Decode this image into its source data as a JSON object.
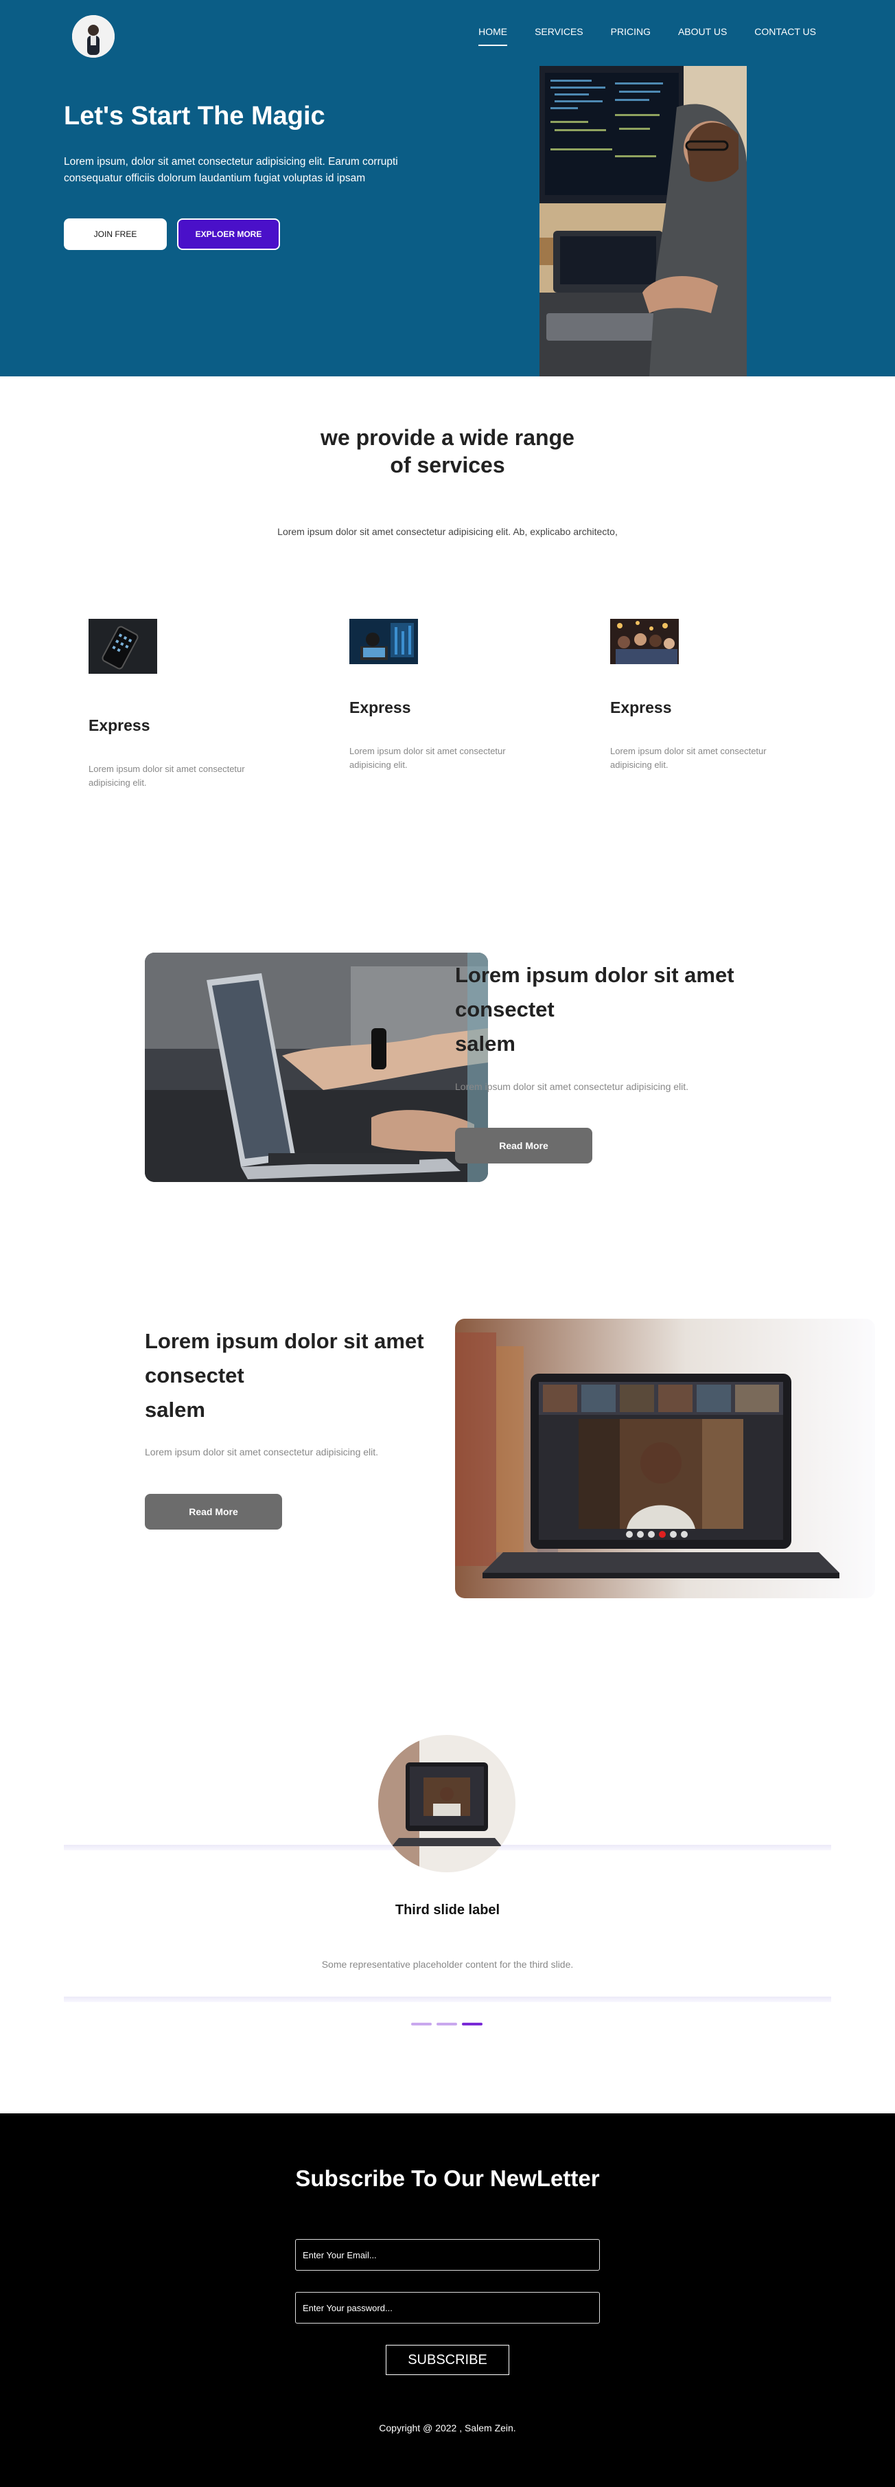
{
  "colors": {
    "hero_bg": "#0b5d86",
    "accent_purple": "#4a10c9",
    "button_grey": "#6c6c6c",
    "footer_bg": "#000000"
  },
  "nav": {
    "items": [
      "HOME",
      "SERVICES",
      "PRICING",
      "ABOUT US",
      "CONTACT US"
    ],
    "active": "HOME"
  },
  "hero": {
    "title": "Let's Start The Magic",
    "text": "Lorem ipsum, dolor sit amet consectetur adipisicing elit. Earum corrupti consequatur officiis dolorum laudantium fugiat voluptas id ipsam",
    "join_label": "JOIN FREE",
    "explore_label": "EXPLOER MORE"
  },
  "services": {
    "title_line1": "we provide a wide range",
    "title_line2": "of services",
    "subtitle": "Lorem ipsum dolor sit amet consectetur adipisicing elit. Ab, explicabo architecto,",
    "cards": [
      {
        "title": "Express",
        "text": "Lorem ipsum dolor sit amet consectetur adipisicing elit."
      },
      {
        "title": "Express",
        "text": "Lorem ipsum dolor sit amet consectetur adipisicing elit."
      },
      {
        "title": "Express",
        "text": "Lorem ipsum dolor sit amet consectetur adipisicing elit."
      }
    ]
  },
  "feature1": {
    "title_line1": "Lorem ipsum dolor sit amet",
    "title_line2": "consectet",
    "title_line3": "salem",
    "text": "Lorem ipsum dolor sit amet consectetur adipisicing elit.",
    "button": "Read More"
  },
  "feature2": {
    "title_line1": "Lorem ipsum dolor sit amet",
    "title_line2": "consectet",
    "title_line3": "salem",
    "text": "Lorem ipsum dolor sit amet consectetur adipisicing elit.",
    "button": "Read More"
  },
  "carousel": {
    "label": "Third slide label",
    "text": "Some representative placeholder content for the third slide.",
    "active_index": 2,
    "slide_count": 3
  },
  "newsletter": {
    "title": "Subscribe To Our NewLetter",
    "email_placeholder": "Enter Your Email...",
    "password_placeholder": "Enter Your password...",
    "button": "SUBSCRIBE",
    "copyright": "Copyright @ 2022 , Salem Zein."
  }
}
